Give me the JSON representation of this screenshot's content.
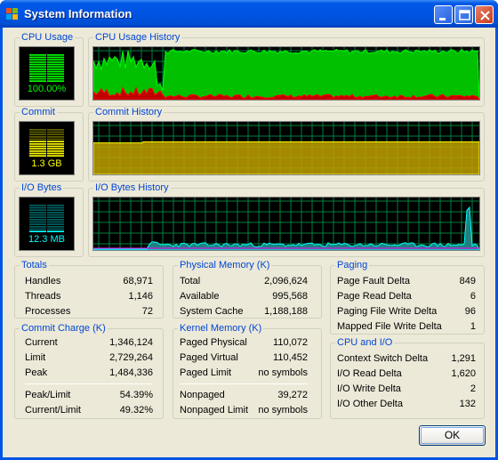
{
  "window": {
    "title": "System Information",
    "icon": "windows-flag-icon"
  },
  "graphs": {
    "cpu_usage": {
      "label": "CPU Usage",
      "value": "100.00%",
      "color": "#00ff00",
      "level": 1.0
    },
    "cpu_history": {
      "label": "CPU Usage History"
    },
    "commit": {
      "label": "Commit",
      "value": "1.3 GB",
      "color": "#ffff00",
      "level": 0.62
    },
    "commit_history": {
      "label": "Commit History"
    },
    "io": {
      "label": "I/O Bytes",
      "value": "12.3  MB",
      "color": "#00ffff",
      "level": 0.1
    },
    "io_history": {
      "label": "I/O Bytes History"
    }
  },
  "totals": {
    "label": "Totals",
    "rows": [
      {
        "k": "Handles",
        "v": "68,971"
      },
      {
        "k": "Threads",
        "v": "1,146"
      },
      {
        "k": "Processes",
        "v": "72"
      }
    ]
  },
  "commit_charge": {
    "label": "Commit Charge (K)",
    "rows": [
      {
        "k": "Current",
        "v": "1,346,124"
      },
      {
        "k": "Limit",
        "v": "2,729,264"
      },
      {
        "k": "Peak",
        "v": "1,484,336"
      },
      {
        "k": "Peak/Limit",
        "v": "54.39%"
      },
      {
        "k": "Current/Limit",
        "v": "49.32%"
      }
    ]
  },
  "physical_memory": {
    "label": "Physical Memory (K)",
    "rows": [
      {
        "k": "Total",
        "v": "2,096,624"
      },
      {
        "k": "Available",
        "v": "995,568"
      },
      {
        "k": "System Cache",
        "v": "1,188,188"
      }
    ]
  },
  "kernel_memory": {
    "label": "Kernel Memory (K)",
    "rows": [
      {
        "k": "Paged Physical",
        "v": "110,072"
      },
      {
        "k": "Paged Virtual",
        "v": "110,452"
      },
      {
        "k": "Paged Limit",
        "v": "no symbols"
      },
      {
        "k": "Nonpaged",
        "v": "39,272"
      },
      {
        "k": "Nonpaged Limit",
        "v": "no symbols"
      }
    ]
  },
  "paging": {
    "label": "Paging",
    "rows": [
      {
        "k": "Page Fault Delta",
        "v": "849"
      },
      {
        "k": "Page Read Delta",
        "v": "6"
      },
      {
        "k": "Paging File Write Delta",
        "v": "96"
      },
      {
        "k": "Mapped File Write Delta",
        "v": "1"
      }
    ]
  },
  "cpu_io": {
    "label": "CPU and I/O",
    "rows": [
      {
        "k": "Context Switch Delta",
        "v": "1,291"
      },
      {
        "k": "I/O Read Delta",
        "v": "1,620"
      },
      {
        "k": "I/O Write Delta",
        "v": "2"
      },
      {
        "k": "I/O Other Delta",
        "v": "132"
      }
    ]
  },
  "buttons": {
    "ok": "OK"
  },
  "colors": {
    "cpu": "#00c000",
    "kernel": "#c00000",
    "commit": "#c0a000",
    "io": "#00c0c0",
    "grid": "#008040"
  }
}
